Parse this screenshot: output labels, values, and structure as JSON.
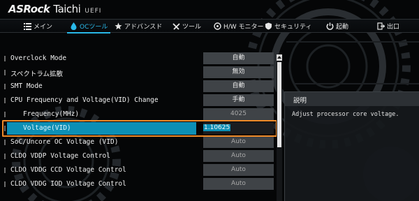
{
  "brand": {
    "logo": "ASRock",
    "model": "Taichi",
    "firmware": "UEFI"
  },
  "tabs": [
    {
      "label": "メイン",
      "icon": "list-icon",
      "active": false
    },
    {
      "label": "OCツール",
      "icon": "droplet-icon",
      "active": true
    },
    {
      "label": "アドバンスド",
      "icon": "star-icon",
      "active": false
    },
    {
      "label": "ツール",
      "icon": "wrench-icon",
      "active": false
    },
    {
      "label": "H/W モニター",
      "icon": "monitor-icon",
      "active": false
    },
    {
      "label": "セキュリティ",
      "icon": "shield-icon",
      "active": false
    },
    {
      "label": "起動",
      "icon": "power-icon",
      "active": false
    },
    {
      "label": "出口",
      "icon": "exit-icon",
      "active": false
    }
  ],
  "settings": [
    {
      "label": "Overclock Mode",
      "value": "自動"
    },
    {
      "label": "スペクトラム拡散",
      "value": "無効"
    },
    {
      "label": "SMT Mode",
      "value": "自動"
    },
    {
      "label": "CPU Frequency and Voltage(VID) Change",
      "value": "手動"
    },
    {
      "label": "Frequency(MHz)",
      "value": "4025"
    },
    {
      "label": "Voltage(VID)",
      "value": "1.10625"
    },
    {
      "label": "SoC/Uncore OC Voltage (VID)",
      "value": "Auto"
    },
    {
      "label": "CLDO VDDP Voltage Control",
      "value": "Auto"
    },
    {
      "label": "CLDO VDDG CCD Voltage Control",
      "value": "Auto"
    },
    {
      "label": "CLDO VDDG IOD Voltage Control",
      "value": "Auto"
    }
  ],
  "description": {
    "title": "説明",
    "text": "Adjust processor core voltage."
  },
  "colors": {
    "accent": "#29b8e8",
    "selection": "#0c8fb5",
    "focus_box": "#ef8a28"
  }
}
